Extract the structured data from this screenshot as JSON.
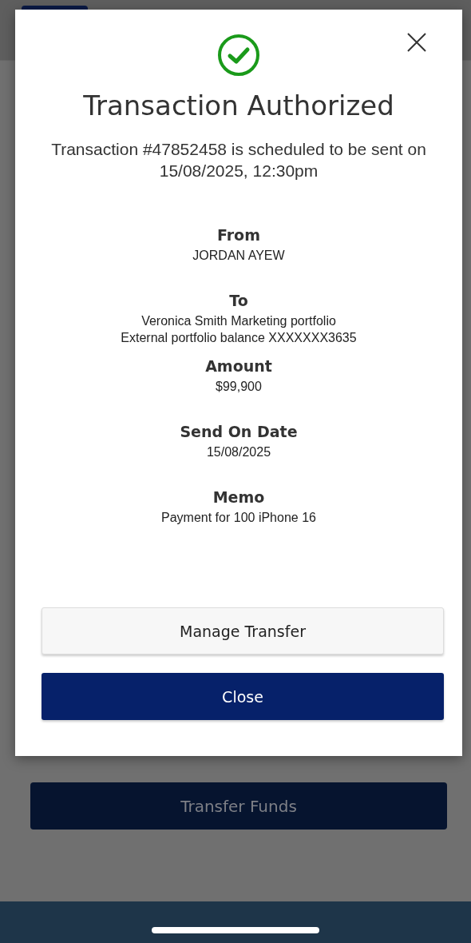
{
  "dialog": {
    "title": "Transaction Authorized",
    "message": "Transaction #47852458 is scheduled to be sent on 15/08/2025, 12:30pm",
    "details": [
      {
        "label": "From",
        "lines": [
          "JORDAN AYEW"
        ]
      },
      {
        "label": "To",
        "lines": [
          "Veronica Smith Marketing portfolio",
          "External portfolio balance XXXXXXX3635"
        ]
      },
      {
        "label": "Amount",
        "lines": [
          "$99,900"
        ]
      },
      {
        "label": "Send On Date",
        "lines": [
          "15/08/2025"
        ]
      },
      {
        "label": "Memo",
        "lines": [
          "Payment for 100 iPhone 16"
        ]
      }
    ],
    "buttons": [
      {
        "label": "Manage Transfer",
        "kind": "secondary"
      },
      {
        "label": "Close",
        "kind": "primary"
      }
    ]
  },
  "page": {
    "button": {
      "label": "Transfer Funds",
      "disabled": true
    }
  }
}
